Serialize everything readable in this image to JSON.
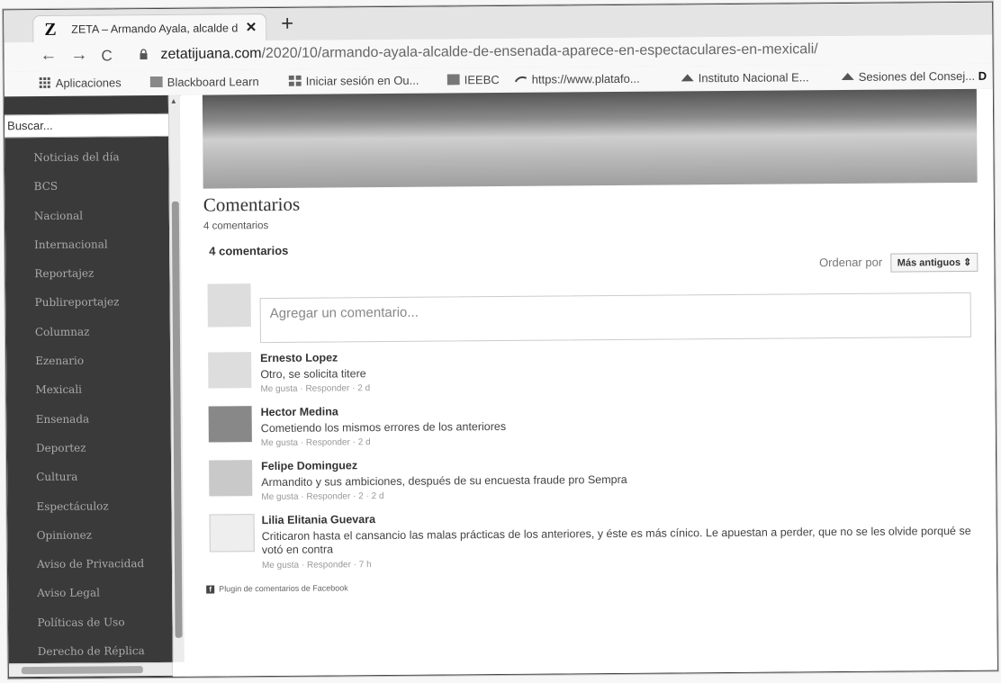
{
  "browser": {
    "tab_title": "ZETA – Armando Ayala, alcalde d",
    "tab_favicon": "Z",
    "tab_close": "✕",
    "new_tab": "+",
    "back": "←",
    "forward": "→",
    "reload": "C",
    "url_host": "zetatijuana.com",
    "url_path": "/2020/10/armando-ayala-alcalde-de-ensenada-aparece-en-espectaculares-en-mexicali/"
  },
  "bookmarks": [
    {
      "label": "Aplicaciones",
      "icon": "apps-grid-icon"
    },
    {
      "label": "Blackboard Learn",
      "icon": "blackboard-icon"
    },
    {
      "label": "Iniciar sesión en Ou...",
      "icon": "outlook-icon"
    },
    {
      "label": "IEEBC",
      "icon": "ieebc-icon"
    },
    {
      "label": "https://www.platafo...",
      "icon": "link-icon"
    },
    {
      "label": "Instituto Nacional E...",
      "icon": "ine-icon"
    },
    {
      "label": "Sesiones del Consej...",
      "icon": "ine-icon"
    },
    {
      "label": "D",
      "icon": "bookmark-icon"
    }
  ],
  "sidebar": {
    "search_placeholder": "Buscar...",
    "items": [
      "Noticias del día",
      "BCS",
      "Nacional",
      "Internacional",
      "Reportajez",
      "Publireportajez",
      "Columnaz",
      "Ezenario",
      "Mexicali",
      "Ensenada",
      "Deportez",
      "Cultura",
      "Espectáculoz",
      "Opinionez",
      "Aviso de Privacidad",
      "Aviso Legal",
      "Políticas de Uso",
      "Derecho de Réplica"
    ]
  },
  "comments_section": {
    "title": "Comentarios",
    "count_label": "4 comentarios",
    "fb_count": "4 comentarios",
    "sort_label": "Ordenar por",
    "sort_value": "Más antiguos",
    "sort_caret": "⇕",
    "compose_placeholder": "Agregar un comentario...",
    "comments": [
      {
        "name": "Ernesto Lopez",
        "text": "Otro, se solicita titere",
        "meta": "Me gusta · Responder · 2 d"
      },
      {
        "name": "Hector Medina",
        "text": "Cometiendo los mismos errores de los anteriores",
        "meta": "Me gusta · Responder · 2 d"
      },
      {
        "name": "Felipe Dominguez",
        "text": "Armandito y sus ambiciones, después de su encuesta fraude pro Sempra",
        "meta": "Me gusta · Responder · 2 · 2 d"
      },
      {
        "name": "Lilia Elitania Guevara",
        "text": "Criticaron hasta el cansancio las malas prácticas de los anteriores, y éste es más cínico. Le apuestan a perder, que no se les olvide porqué se votó en contra",
        "meta": "Me gusta · Responder · 7 h"
      }
    ],
    "plugin_label": "Plugin de comentarios de Facebook",
    "plugin_icon": "f"
  }
}
